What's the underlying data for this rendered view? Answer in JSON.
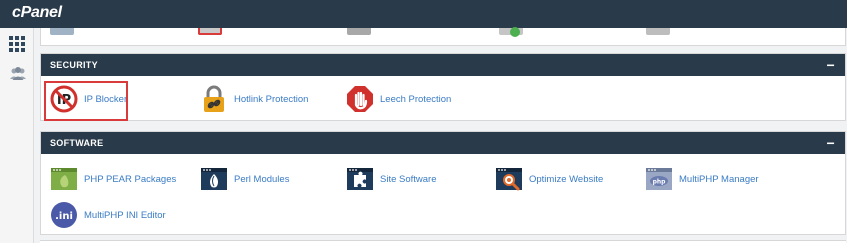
{
  "app": {
    "logo": "cPanel"
  },
  "nav": {
    "items": [
      {
        "name": "home-grid-icon"
      },
      {
        "name": "users-icon"
      }
    ]
  },
  "security": {
    "title": "SECURITY",
    "collapse_symbol": "−",
    "items": [
      {
        "label": "IP Blocker",
        "icon": "ip-blocker-icon",
        "selected": true
      },
      {
        "label": "Hotlink Protection",
        "icon": "padlock-link-icon"
      },
      {
        "label": "Leech Protection",
        "icon": "stop-hand-icon"
      }
    ]
  },
  "software": {
    "title": "SOFTWARE",
    "collapse_symbol": "−",
    "items": [
      {
        "label": "PHP PEAR Packages",
        "icon": "pear-icon"
      },
      {
        "label": "Perl Modules",
        "icon": "perl-onion-icon"
      },
      {
        "label": "Site Software",
        "icon": "puzzle-icon"
      },
      {
        "label": "Optimize Website",
        "icon": "magnifier-icon"
      },
      {
        "label": "MultiPHP Manager",
        "icon": "php-window-icon"
      },
      {
        "label": "MultiPHP INI Editor",
        "icon": "ini-file-icon"
      }
    ]
  },
  "colors": {
    "header_bg": "#293a4a",
    "link": "#3a7cc5",
    "highlight": "#d93b3b"
  }
}
